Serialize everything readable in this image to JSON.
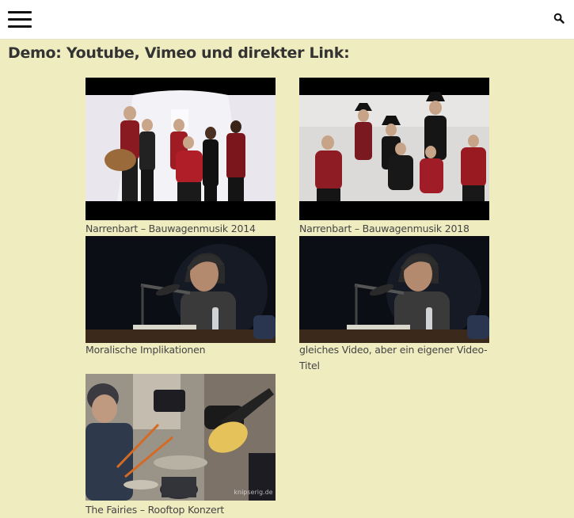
{
  "header": {
    "menu_icon": "hamburger-menu-icon",
    "search_icon": "search-icon"
  },
  "page": {
    "heading": "Demo: Youtube, Vimeo und direkter Link:"
  },
  "videos": [
    {
      "caption": "Narrenbart – Bauwagenmusik 2014"
    },
    {
      "caption": "Narrenbart – Bauwagenmusik 2018"
    },
    {
      "caption": "Moralische Implikationen"
    },
    {
      "caption": "gleiches Video, aber ein eigener Video-Titel"
    },
    {
      "caption": "The Fairies – Rooftop Konzert",
      "watermark": "knipserig.de"
    }
  ],
  "colors": {
    "page_background": "#efedc0",
    "header_background": "#ffffff",
    "text": "#333333"
  }
}
